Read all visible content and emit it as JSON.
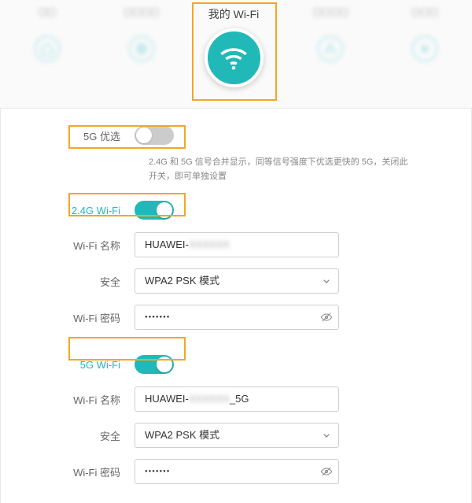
{
  "header": {
    "centerTitle": "我的 Wi-Fi"
  },
  "pref5g": {
    "label": "5G 优选",
    "desc": "2.4G 和 5G 信号合并显示，同等信号强度下优选更快的 5G，关闭此开关，即可单独设置"
  },
  "wifi24": {
    "sectionLabel": "2.4G Wi-Fi",
    "nameLabel": "Wi-Fi 名称",
    "nameValue": "HUAWEI-",
    "securityLabel": "安全",
    "securityValue": "WPA2 PSK 模式",
    "passwordLabel": "Wi-Fi 密码",
    "passwordValue": "●●●●●●●"
  },
  "wifi5": {
    "sectionLabel": "5G Wi-Fi",
    "nameLabel": "Wi-Fi 名称",
    "nameValue": "HUAWEI-",
    "nameSuffix": "_5G",
    "securityLabel": "安全",
    "securityValue": "WPA2 PSK 模式",
    "passwordLabel": "Wi-Fi 密码",
    "passwordValue": "●●●●●●●"
  }
}
